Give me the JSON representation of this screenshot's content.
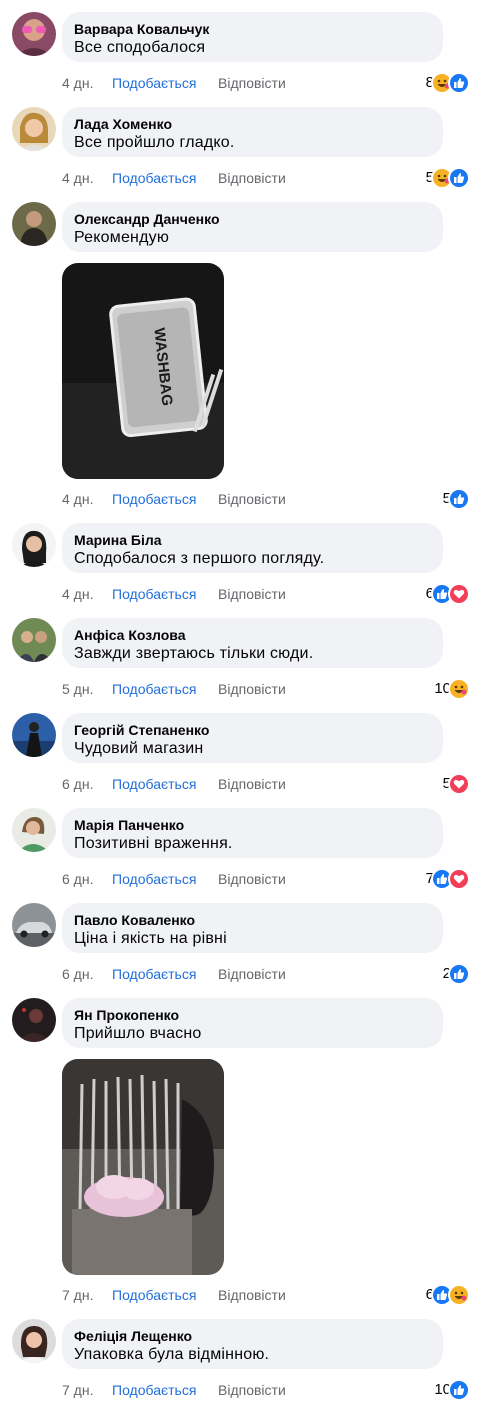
{
  "actions": {
    "like": "Подобається",
    "reply": "Відповісти"
  },
  "comments": [
    {
      "author": "Варвара Ковальчук",
      "text": "Все сподобалося",
      "time": "4 дн.",
      "count": "8",
      "reactions": [
        "haha",
        "like"
      ]
    },
    {
      "author": "Лада Хоменко",
      "text": "Все пройшло гладко.",
      "time": "4 дн.",
      "count": "5",
      "reactions": [
        "haha",
        "like"
      ]
    },
    {
      "author": "Олександр Данченко",
      "text": "Рекомендую",
      "time": "4 дн.",
      "count": "5",
      "reactions": [
        "like"
      ],
      "photo_text": "WASHBAG"
    },
    {
      "author": "Марина Біла",
      "text": "Сподобалося з першого погляду.",
      "time": "4 дн.",
      "count": "6",
      "reactions": [
        "like",
        "love"
      ]
    },
    {
      "author": "Анфіса Козлова",
      "text": "Завжди звертаюсь тільки сюди.",
      "time": "5 дн.",
      "count": "10",
      "reactions": [
        "haha"
      ]
    },
    {
      "author": "Георгій Степаненко",
      "text": "Чудовий магазин",
      "time": "6 дн.",
      "count": "5",
      "reactions": [
        "love"
      ]
    },
    {
      "author": "Марія Панченко",
      "text": "Позитивні враження.",
      "time": "6 дн.",
      "count": "7",
      "reactions": [
        "like",
        "love"
      ]
    },
    {
      "author": "Павло Коваленко",
      "text": "Ціна і якість на рівні",
      "time": "6 дн.",
      "count": "2",
      "reactions": [
        "like"
      ]
    },
    {
      "author": "Ян Прокопенко",
      "text": "Прийшло вчасно",
      "time": "7 дн.",
      "count": "6",
      "reactions": [
        "like",
        "haha"
      ]
    },
    {
      "author": "Феліція Лещенко",
      "text": "Упаковка була відмінною.",
      "time": "7 дн.",
      "count": "10",
      "reactions": [
        "like"
      ]
    }
  ],
  "colors": {
    "like_link": "#216fdb",
    "muted": "#65676b",
    "bubble": "#f0f2f5",
    "like_icon": "#1877f2",
    "love_icon": "#f33e58",
    "haha_icon": "#f7b125"
  }
}
